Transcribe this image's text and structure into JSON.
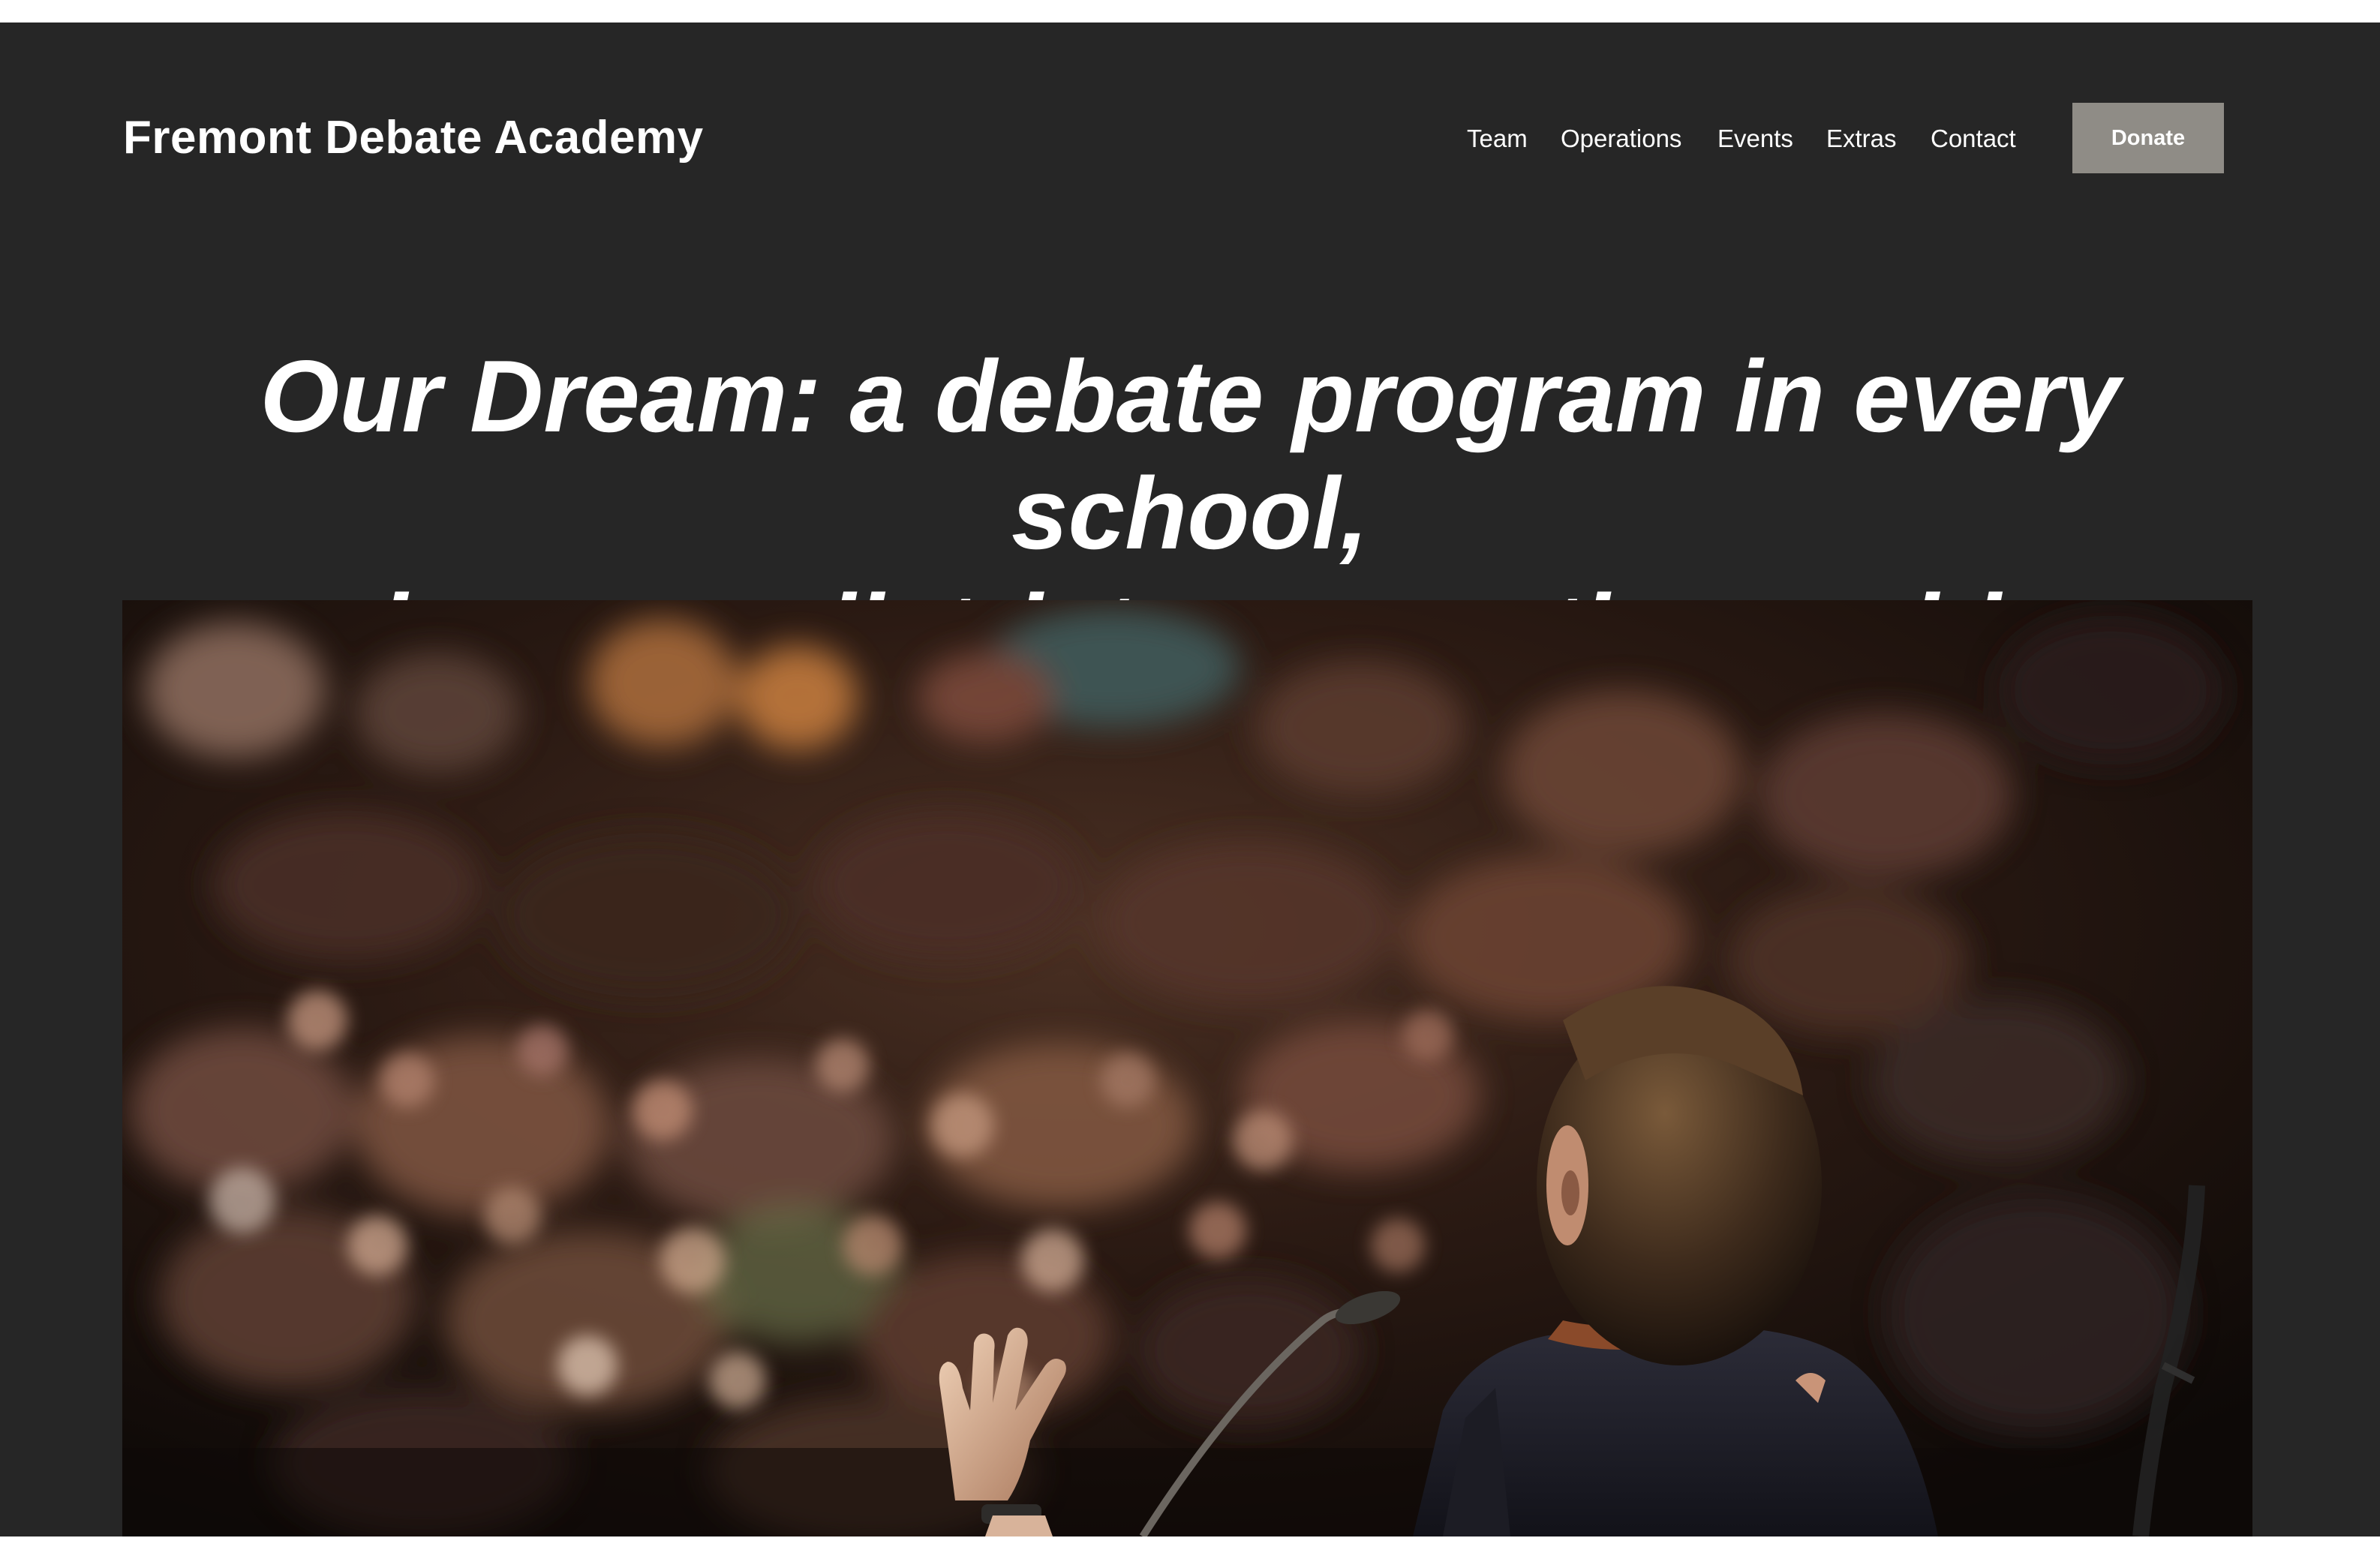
{
  "site": {
    "brand": "Fremont Debate Academy"
  },
  "nav": {
    "items": [
      "Team",
      "Operations",
      "Events",
      "Extras",
      "Contact"
    ],
    "donate_label": "Donate"
  },
  "hero": {
    "title_line1": "Our Dream: a debate program in every school,",
    "title_line2": "in every district, across the world",
    "image_icon": "speaker-at-podium-photo"
  },
  "colors": {
    "page_background": "#262626",
    "top_strip": "#ffffff",
    "donate_background": "#8f8c86",
    "text": "#ffffff"
  }
}
